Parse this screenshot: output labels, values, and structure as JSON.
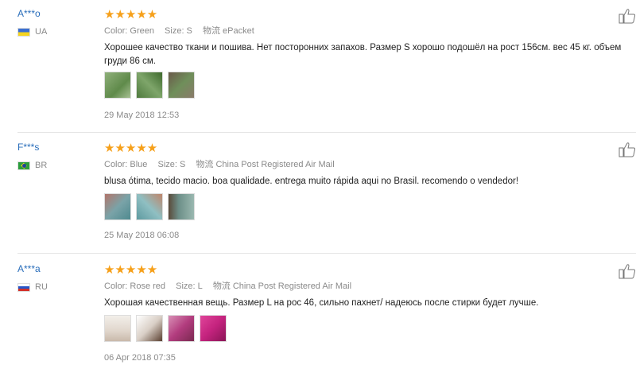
{
  "reviews": [
    {
      "user": "A***o",
      "country": "UA",
      "stars": "★★★★★",
      "color": "Color: Green",
      "size": "Size: S",
      "shipping": "物流 ePacket",
      "text": "Хорошее качество ткани и пошива. Нет посторонних запахов. Размер S хорошо подошёл на рост 156см. вес 45 кг. объем груди 86 см.",
      "date": "29 May 2018 12:53",
      "thumb_colors": [
        "#6e9a5a",
        "#5f8a4a",
        "#7a8a6a"
      ]
    },
    {
      "user": "F***s",
      "country": "BR",
      "stars": "★★★★★",
      "color": "Color: Blue",
      "size": "Size: S",
      "shipping": "物流 China Post Registered Air Mail",
      "text": "blusa ótima, tecido macio. boa qualidade. entrega muito rápida aqui no Brasil. recomendo o vendedor!",
      "date": "25 May 2018 06:08",
      "thumb_colors": [
        "#7aa3a8",
        "#5e9aa0",
        "#6d8f88"
      ]
    },
    {
      "user": "A***a",
      "country": "RU",
      "stars": "★★★★★",
      "color": "Color: Rose red",
      "size": "Size: L",
      "shipping": "物流 China Post Registered Air Mail",
      "text": "Хорошая качественная вещь. Размер L на рос 46, сильно пахнет/ надеюсь после стирки будет лучше.",
      "date": "06 Apr 2018 07:35",
      "thumb_colors": [
        "#e8e2dc",
        "#d9cfc6",
        "#b23c7e",
        "#c4237e"
      ]
    }
  ],
  "colors": {
    "star": "#f6a01a",
    "username": "#2a6ebb",
    "meta": "#8a8a8a"
  }
}
